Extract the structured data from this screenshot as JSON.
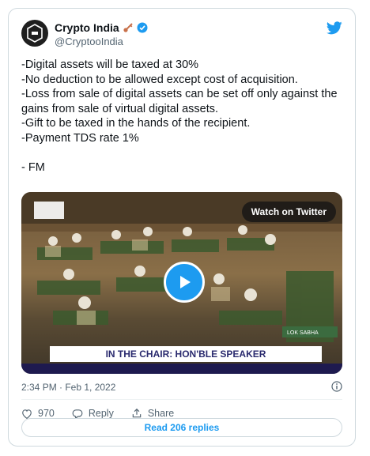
{
  "author": {
    "display_name": "Crypto India",
    "handle": "@CryptooIndia",
    "avatar_icon": "crypto-india-logo",
    "verified": true
  },
  "tweet": {
    "lines": [
      "-Digital assets will be taxed at 30%",
      "-No deduction to be allowed except cost of acquisition.",
      "-Loss from sale of digital assets can be set off only against the gains from sale of virtual digital assets.",
      "-Gift to be taxed in the hands of the recipient.",
      "-Payment TDS rate 1%",
      "",
      "- FM"
    ]
  },
  "media": {
    "watch_label": "Watch on Twitter",
    "banner_text": "IN THE CHAIR: HON'BLE SPEAKER",
    "corner_tag": "LOK SABHA"
  },
  "meta": {
    "timestamp": "2:34 PM · Feb 1, 2022"
  },
  "actions": {
    "likes": "970",
    "reply_label": "Reply",
    "share_label": "Share"
  },
  "read_replies": "Read 206 replies",
  "colors": {
    "accent": "#1d9bf0",
    "text": "#0f1419",
    "muted": "#536471"
  }
}
